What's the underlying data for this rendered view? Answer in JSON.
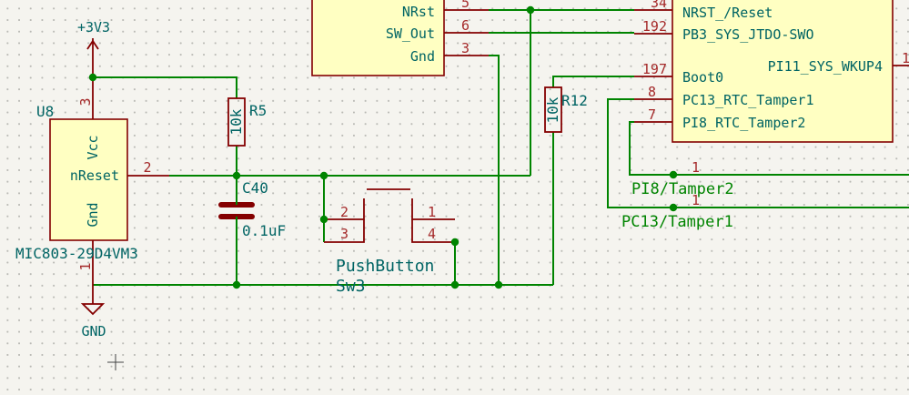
{
  "mcu": {
    "pins_left": [
      {
        "number": "34",
        "name": "NRST_/Reset"
      },
      {
        "number": "192",
        "name": "PB3_SYS_JTDO-SWO"
      },
      {
        "number": "197",
        "name": "Boot0"
      },
      {
        "number": "8",
        "name": "PC13_RTC_Tamper1"
      },
      {
        "number": "7",
        "name": "PI8_RTC_Tamper2"
      }
    ],
    "pin_right_name": "PI11_SYS_WKUP4",
    "pin_right_number": "1"
  },
  "debug_connector": {
    "pins": [
      {
        "name": "NRst",
        "number": "5"
      },
      {
        "name": "SW_Out",
        "number": "6"
      },
      {
        "name": "Gnd",
        "number": "3"
      }
    ]
  },
  "u8": {
    "reference": "U8",
    "value": "MIC803-29D4VM3",
    "pin_vcc_name": "Vcc",
    "pin_vcc_number": "3",
    "pin_reset_name": "nReset",
    "pin_reset_number": "2",
    "pin_gnd_name": "Gnd",
    "pin_gnd_number": "1"
  },
  "r5": {
    "reference": "R5",
    "value": "10k"
  },
  "r12": {
    "reference": "R12",
    "value": "10k"
  },
  "c40": {
    "reference": "C40",
    "value": "0.1uF"
  },
  "sw3": {
    "label": "PushButton",
    "reference": "Sw3",
    "pin1": "1",
    "pin2": "2",
    "pin3": "3",
    "pin4": "4"
  },
  "power": {
    "supply": "+3V3",
    "ground": "GND"
  },
  "nets": {
    "tamper2_label": "PI8/Tamper2",
    "tamper2_pin": "1",
    "tamper1_label": "PC13/Tamper1",
    "tamper1_pin": "1"
  },
  "colors": {
    "wire": "#008400",
    "component_outline": "#840000",
    "component_fill": "#ffffc2",
    "pin_number": "#a52a2a",
    "text": "#006464",
    "background": "#f5f4ef"
  }
}
